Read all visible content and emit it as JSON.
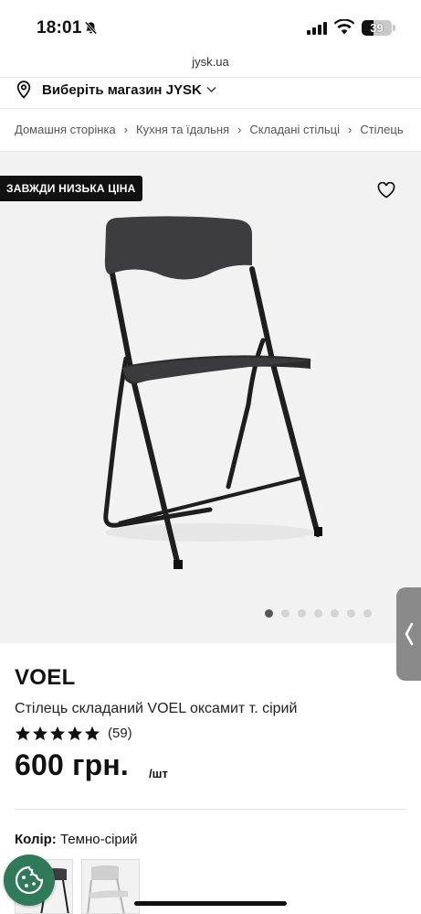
{
  "status_bar": {
    "time": "18:01",
    "battery": "39",
    "battery_level": 0.39
  },
  "browser": {
    "url": "jysk.ua"
  },
  "store": {
    "label": "Виберіть магазин JYSK",
    "icon": "location-pin-icon"
  },
  "breadcrumb": [
    "Домашня сторінка",
    "Кухня та їдальня",
    "Складані стільці",
    "Стілець"
  ],
  "hero": {
    "badge": "ЗАВЖДИ НИЗЬКА ЦІНА",
    "images_total": 7,
    "active_image": 1,
    "image_subject": "folding-chair-dark-grey"
  },
  "product": {
    "brand": "VOEL",
    "name": "Стілець складаний VOEL оксамит т. сірий",
    "rating": 5,
    "review_count": "(59)",
    "price": "600 грн.",
    "unit": "/шт",
    "color_label": "Колір:",
    "color_value": "Темно-сірий"
  },
  "colors": {
    "accent": "#111111",
    "cookie": "#2f7a5a",
    "hero_bg": "#f2f2f2"
  }
}
